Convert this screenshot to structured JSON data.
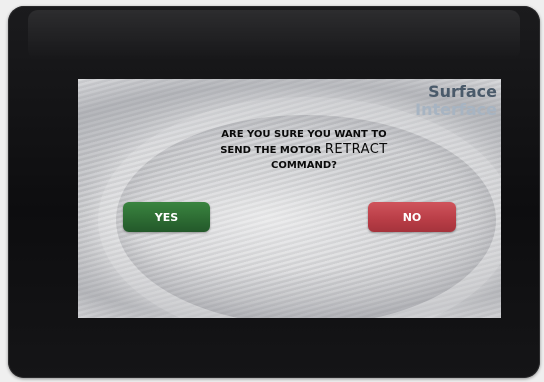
{
  "brand": {
    "line1": "Surface",
    "line2": "Interface"
  },
  "dialog": {
    "line1": "ARE YOU SURE YOU WANT TO",
    "line2_prefix": "SEND THE MOTOR",
    "command": "RETRACT",
    "line3": "COMMAND?"
  },
  "buttons": {
    "yes_label": "YES",
    "no_label": "NO"
  },
  "colors": {
    "yes": "#2c6a32",
    "no": "#b83d46",
    "brand_dark": "#4a5a6a",
    "brand_light": "#a7b4c2"
  }
}
